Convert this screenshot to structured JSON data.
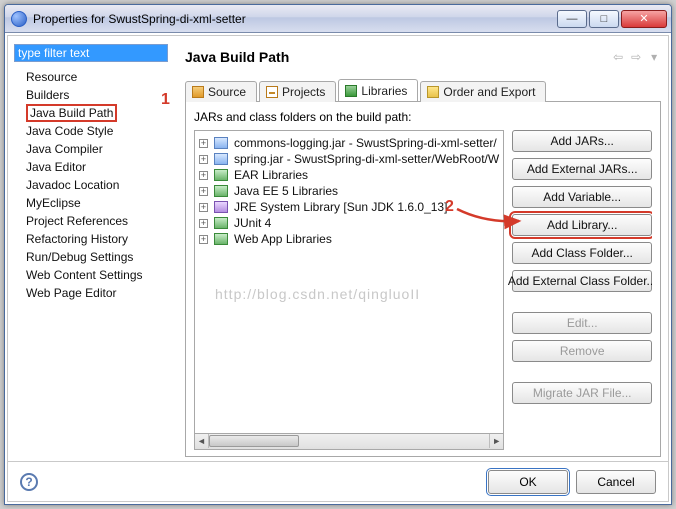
{
  "window": {
    "title": "Properties for SwustSpring-di-xml-setter"
  },
  "filter": {
    "placeholder": "type filter text"
  },
  "tree": {
    "items": [
      {
        "label": "Resource"
      },
      {
        "label": "Builders"
      },
      {
        "label": "Java Build Path",
        "highlight": true
      },
      {
        "label": "Java Code Style"
      },
      {
        "label": "Java Compiler"
      },
      {
        "label": "Java Editor"
      },
      {
        "label": "Javadoc Location"
      },
      {
        "label": "MyEclipse"
      },
      {
        "label": "Project References"
      },
      {
        "label": "Refactoring History"
      },
      {
        "label": "Run/Debug Settings"
      },
      {
        "label": "Web Content Settings"
      },
      {
        "label": "Web Page Editor"
      }
    ]
  },
  "header": {
    "title": "Java Build Path"
  },
  "tabs": [
    {
      "label": "Source",
      "icon": "source"
    },
    {
      "label": "Projects",
      "icon": "projects"
    },
    {
      "label": "Libraries",
      "icon": "lib",
      "active": true
    },
    {
      "label": "Order and Export",
      "icon": "order"
    }
  ],
  "body": {
    "label": "JARs and class folders on the build path:",
    "items": [
      {
        "label": "commons-logging.jar - SwustSpring-di-xml-setter/",
        "icon": "jar"
      },
      {
        "label": "spring.jar - SwustSpring-di-xml-setter/WebRoot/W",
        "icon": "jar"
      },
      {
        "label": "EAR Libraries",
        "icon": "lib"
      },
      {
        "label": "Java EE 5 Libraries",
        "icon": "lib"
      },
      {
        "label": "JRE System Library [Sun JDK 1.6.0_13]",
        "icon": "sys"
      },
      {
        "label": "JUnit 4",
        "icon": "lib"
      },
      {
        "label": "Web App Libraries",
        "icon": "lib"
      }
    ],
    "watermark": "http://blog.csdn.net/qingluoII"
  },
  "buttons": [
    {
      "label": "Add JARs...",
      "state": "enabled"
    },
    {
      "label": "Add External JARs...",
      "state": "enabled"
    },
    {
      "label": "Add Variable...",
      "state": "enabled"
    },
    {
      "label": "Add Library...",
      "state": "enabled",
      "highlight": true
    },
    {
      "label": "Add Class Folder...",
      "state": "enabled"
    },
    {
      "label": "Add External Class Folder...",
      "state": "enabled"
    },
    {
      "label": "Edit...",
      "state": "disabled"
    },
    {
      "label": "Remove",
      "state": "disabled"
    },
    {
      "label": "Migrate JAR File...",
      "state": "disabled"
    }
  ],
  "footer": {
    "ok": "OK",
    "cancel": "Cancel"
  },
  "annotations": {
    "one": "1",
    "two": "2"
  }
}
